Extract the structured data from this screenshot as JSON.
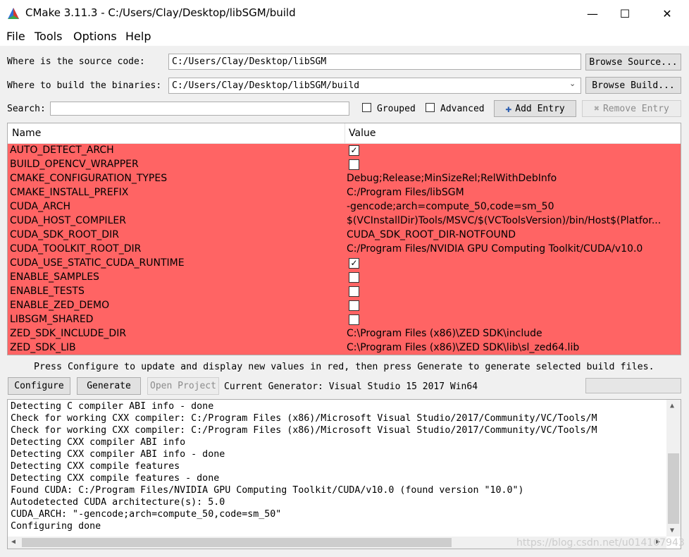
{
  "window": {
    "title": "CMake 3.11.3 - C:/Users/Clay/Desktop/libSGM/build",
    "minimize": "—",
    "maximize": "☐",
    "close": "✕"
  },
  "menu": [
    "File",
    "Tools",
    "Options",
    "Help"
  ],
  "source": {
    "label": "Where is the source code:",
    "value": "C:/Users/Clay/Desktop/libSGM",
    "browse": "Browse Source..."
  },
  "build": {
    "label": "Where to build the binaries:",
    "value": "C:/Users/Clay/Desktop/libSGM/build",
    "browse": "Browse Build..."
  },
  "search": {
    "label": "Search:",
    "value": "",
    "grouped": "Grouped",
    "advanced": "Advanced",
    "add": "Add Entry",
    "remove": "Remove Entry"
  },
  "table": {
    "col_name": "Name",
    "col_value": "Value",
    "rows": [
      {
        "name": "AUTO_DETECT_ARCH",
        "value": "",
        "checkbox": true,
        "checked": true
      },
      {
        "name": "BUILD_OPENCV_WRAPPER",
        "value": "",
        "checkbox": true,
        "checked": false
      },
      {
        "name": "CMAKE_CONFIGURATION_TYPES",
        "value": "Debug;Release;MinSizeRel;RelWithDebInfo",
        "checkbox": false
      },
      {
        "name": "CMAKE_INSTALL_PREFIX",
        "value": "C:/Program Files/libSGM",
        "checkbox": false
      },
      {
        "name": "CUDA_ARCH",
        "value": "-gencode;arch=compute_50,code=sm_50",
        "checkbox": false
      },
      {
        "name": "CUDA_HOST_COMPILER",
        "value": "$(VCInstallDir)Tools/MSVC/$(VCToolsVersion)/bin/Host$(Platfor...",
        "checkbox": false
      },
      {
        "name": "CUDA_SDK_ROOT_DIR",
        "value": "CUDA_SDK_ROOT_DIR-NOTFOUND",
        "checkbox": false
      },
      {
        "name": "CUDA_TOOLKIT_ROOT_DIR",
        "value": "C:/Program Files/NVIDIA GPU Computing Toolkit/CUDA/v10.0",
        "checkbox": false
      },
      {
        "name": "CUDA_USE_STATIC_CUDA_RUNTIME",
        "value": "",
        "checkbox": true,
        "checked": true
      },
      {
        "name": "ENABLE_SAMPLES",
        "value": "",
        "checkbox": true,
        "checked": false
      },
      {
        "name": "ENABLE_TESTS",
        "value": "",
        "checkbox": true,
        "checked": false
      },
      {
        "name": "ENABLE_ZED_DEMO",
        "value": "",
        "checkbox": true,
        "checked": false
      },
      {
        "name": "LIBSGM_SHARED",
        "value": "",
        "checkbox": true,
        "checked": false
      },
      {
        "name": "ZED_SDK_INCLUDE_DIR",
        "value": "C:\\Program Files (x86)\\ZED SDK\\include",
        "checkbox": false
      },
      {
        "name": "ZED_SDK_LIB",
        "value": "C:\\Program Files (x86)\\ZED SDK\\lib\\sl_zed64.lib",
        "checkbox": false
      }
    ]
  },
  "hint": "Press Configure to update and display new values in red, then press Generate to generate selected build files.",
  "actions": {
    "configure": "Configure",
    "generate": "Generate",
    "open_project": "Open Project",
    "generator": "Current Generator: Visual Studio 15 2017 Win64"
  },
  "log": [
    "Detecting C compiler ABI info - done",
    "Check for working CXX compiler: C:/Program Files (x86)/Microsoft Visual Studio/2017/Community/VC/Tools/M",
    "Check for working CXX compiler: C:/Program Files (x86)/Microsoft Visual Studio/2017/Community/VC/Tools/M",
    "Detecting CXX compiler ABI info",
    "Detecting CXX compiler ABI info - done",
    "Detecting CXX compile features",
    "Detecting CXX compile features - done",
    "Found CUDA: C:/Program Files/NVIDIA GPU Computing Toolkit/CUDA/v10.0 (found version \"10.0\")",
    "Autodetected CUDA architecture(s): 5.0",
    "CUDA_ARCH: \"-gencode;arch=compute_50,code=sm_50\"",
    "Configuring done"
  ],
  "watermark": "https://blog.csdn.net/u014107943",
  "colors": {
    "changed_row": "#ff6464",
    "window_bg": "#f0f0f0",
    "add_icon": "#2a5db0"
  },
  "icons": {
    "app": "cmake-triangle-icon",
    "add": "plus-icon",
    "remove": "x-icon",
    "combo": "chevron-down-icon"
  }
}
